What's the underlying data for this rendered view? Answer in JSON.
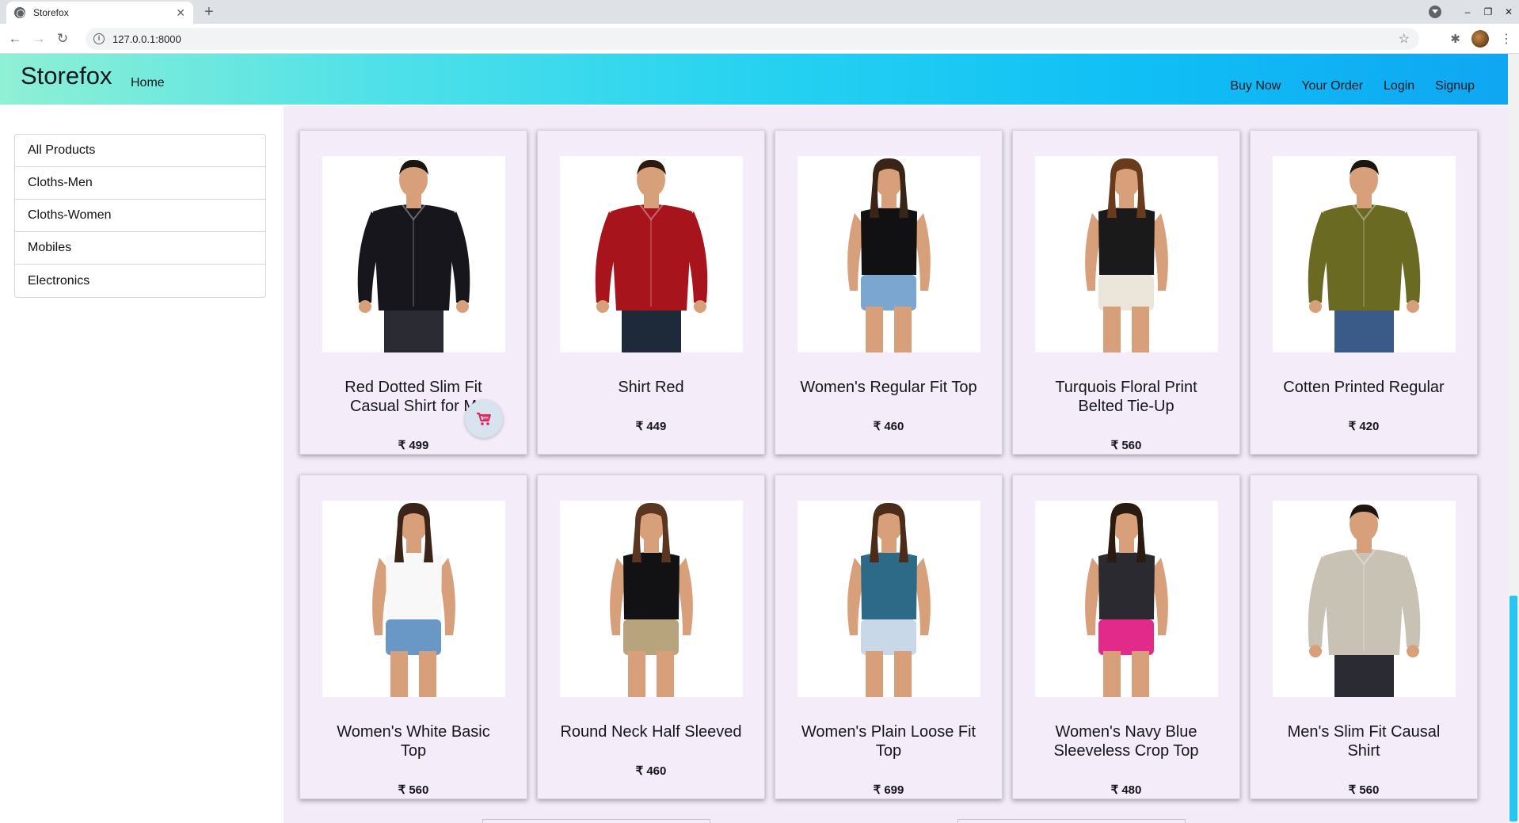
{
  "browser": {
    "tab_title": "Storefox",
    "tab_close": "✕",
    "new_tab": "+",
    "url": "127.0.0.1:8000",
    "back": "←",
    "forward": "→",
    "reload": "↻",
    "info": "i",
    "star": "☆",
    "extensions": "✱",
    "menu": "⋮",
    "minimize": "–",
    "restore": "❐",
    "close": "✕"
  },
  "navbar": {
    "brand": "Storefox",
    "home": "Home",
    "links": [
      "Buy Now",
      "Your Order",
      "Login",
      "Signup"
    ],
    "gradient": [
      "#8ff0d4",
      "#4fe1e8",
      "#27d2f0",
      "#10c0f5",
      "#0fa6f2"
    ]
  },
  "sidebar": {
    "categories": [
      "All Products",
      "Cloths-Men",
      "Cloths-Women",
      "Mobiles",
      "Electronics"
    ]
  },
  "products": [
    {
      "name_lines": [
        "Red Dotted Slim Fit",
        "Casual Shirt for M"
      ],
      "price": "₹ 499",
      "icon": "shirt-icon",
      "garment": "#16161c",
      "bottom": "#2b2b33",
      "hair": "#1b1410"
    },
    {
      "name_lines": [
        "Shirt Red"
      ],
      "price": "₹ 449",
      "icon": "shirt-icon",
      "garment": "#a8141c",
      "bottom": "#1e2a3a",
      "hair": "#2a1a10"
    },
    {
      "name_lines": [
        "Women's Regular Fit Top"
      ],
      "price": "₹ 460",
      "icon": "top-icon",
      "garment": "#111114",
      "bottom": "#7aa6cf",
      "hair": "#3a2418"
    },
    {
      "name_lines": [
        "Turquois Floral Print",
        "Belted Tie-Up"
      ],
      "price": "₹ 560",
      "icon": "top-icon",
      "garment": "#1a1a1a",
      "bottom": "#ece6da",
      "hair": "#6a3a1c"
    },
    {
      "name_lines": [
        "Cotten Printed Regular"
      ],
      "price": "₹ 420",
      "icon": "shirt-icon",
      "garment": "#6a6a22",
      "bottom": "#3a5a88",
      "hair": "#1b1410"
    },
    {
      "name_lines": [
        "Women's White Basic",
        "Top"
      ],
      "price": "₹ 560",
      "icon": "top-icon",
      "garment": "#f8f8f8",
      "bottom": "#6a98c6",
      "hair": "#3a2418"
    },
    {
      "name_lines": [
        "Round Neck Half Sleeved"
      ],
      "price": "₹ 460",
      "icon": "top-icon",
      "garment": "#121214",
      "bottom": "#b8a47c",
      "hair": "#5a3620"
    },
    {
      "name_lines": [
        "Women's Plain Loose Fit",
        "Top"
      ],
      "price": "₹ 699",
      "icon": "top-icon",
      "garment": "#2c6a88",
      "bottom": "#c8d8e8",
      "hair": "#4a2c18"
    },
    {
      "name_lines": [
        "Women's Navy Blue",
        "Sleeveless Crop Top"
      ],
      "price": "₹ 480",
      "icon": "top-icon",
      "garment": "#2a2a30",
      "bottom": "#e22a8a",
      "hair": "#2a1a10"
    },
    {
      "name_lines": [
        "Men's Slim Fit Causal",
        "Shirt"
      ],
      "price": "₹ 560",
      "icon": "shirt-icon",
      "garment": "#c8c2b4",
      "bottom": "#2b2b33",
      "hair": "#1b1410"
    }
  ],
  "cart_icon": "cart-icon"
}
